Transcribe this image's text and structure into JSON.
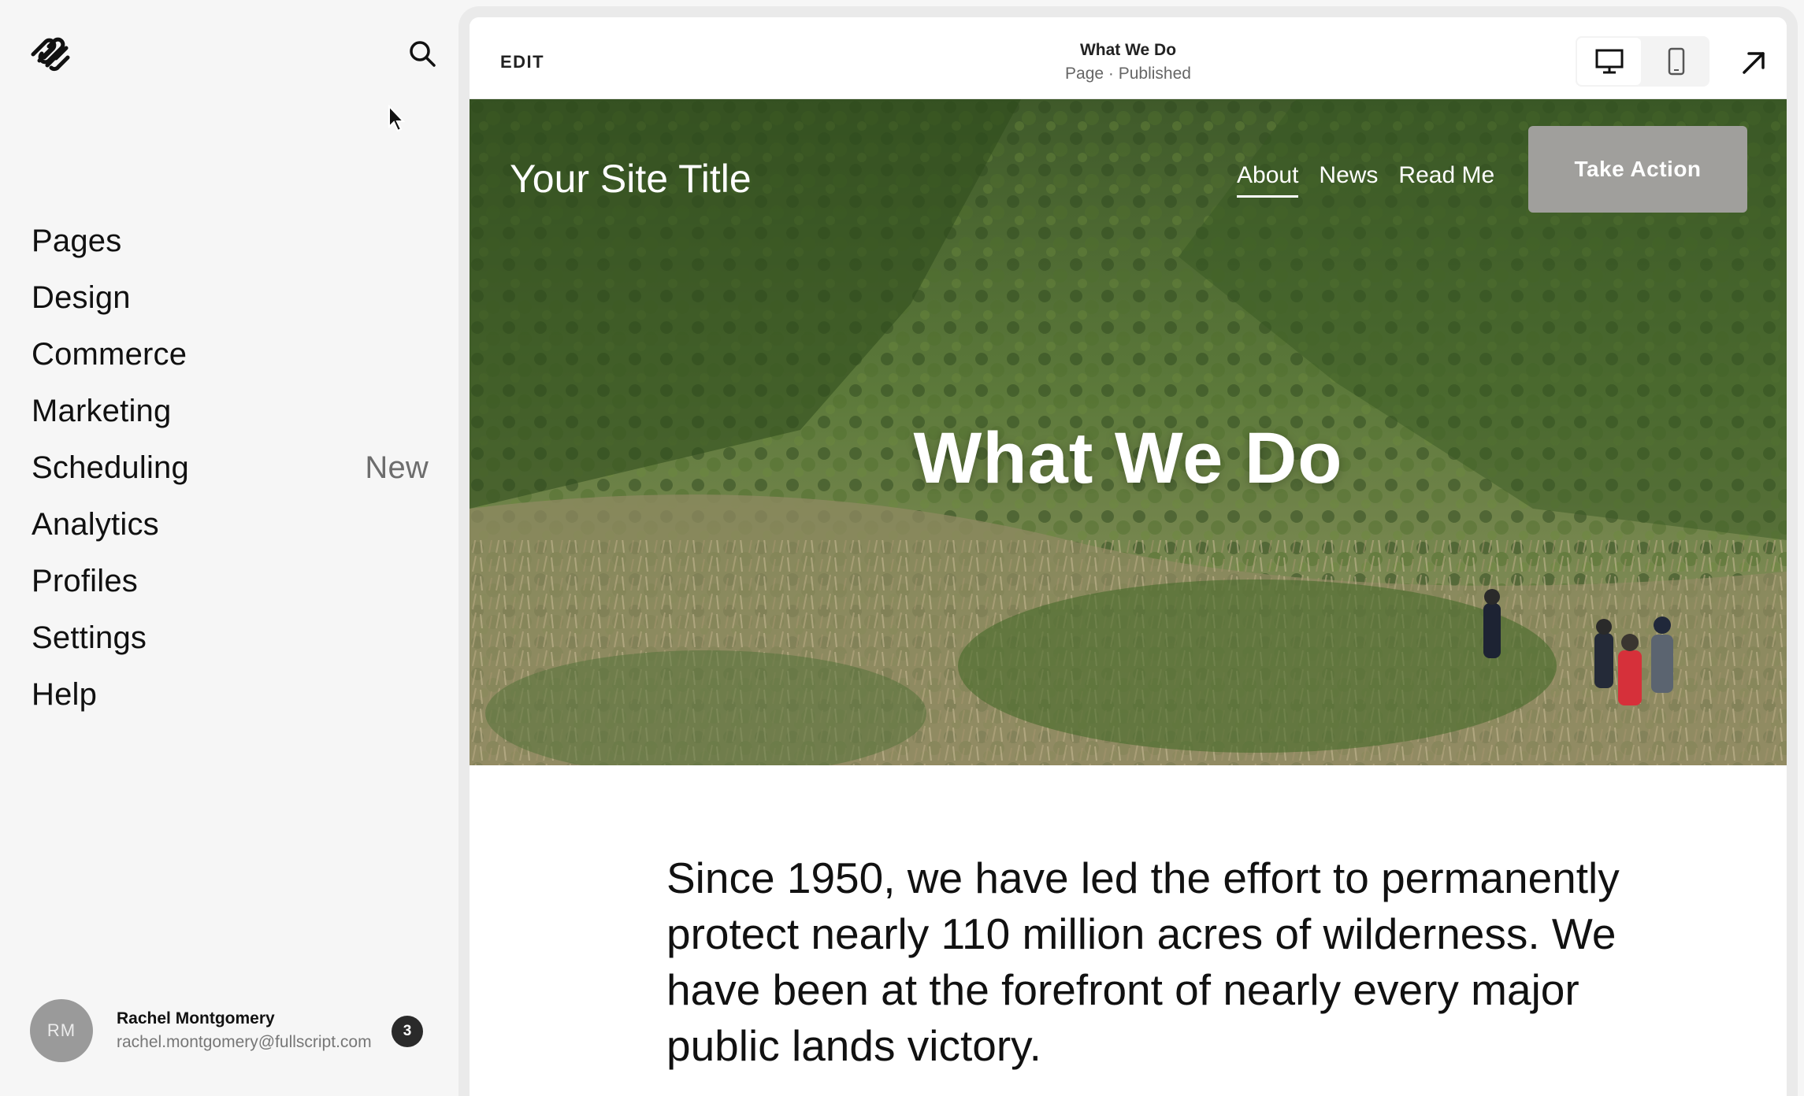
{
  "sidebar": {
    "nav": [
      {
        "label": "Pages",
        "badge": ""
      },
      {
        "label": "Design",
        "badge": ""
      },
      {
        "label": "Commerce",
        "badge": ""
      },
      {
        "label": "Marketing",
        "badge": ""
      },
      {
        "label": "Scheduling",
        "badge": "New"
      },
      {
        "label": "Analytics",
        "badge": ""
      },
      {
        "label": "Profiles",
        "badge": ""
      },
      {
        "label": "Settings",
        "badge": ""
      },
      {
        "label": "Help",
        "badge": ""
      }
    ],
    "user": {
      "initials": "RM",
      "name": "Rachel Montgomery",
      "email": "rachel.montgomery@fullscript.com",
      "notifications": "3"
    }
  },
  "toolbar": {
    "edit_label": "EDIT",
    "page_title": "What We Do",
    "page_status": "Page · Published",
    "views": [
      "desktop-icon",
      "mobile-icon"
    ],
    "active_view": "desktop"
  },
  "site": {
    "title": "Your Site Title",
    "nav": [
      "About",
      "News",
      "Read Me"
    ],
    "current_nav": "About",
    "cta_label": "Take Action",
    "hero_heading": "What We Do",
    "intro": "Since 1950, we have led the effort to permanently protect nearly 110 million acres of wilderness. We have been at the forefront of nearly every major public lands victory."
  },
  "colors": {
    "sidebar_bg": "#f6f6f6",
    "cta_bg": "#a09f9c",
    "badge_bg": "#2a2a2a",
    "avatar_bg": "#9a9a9a"
  }
}
